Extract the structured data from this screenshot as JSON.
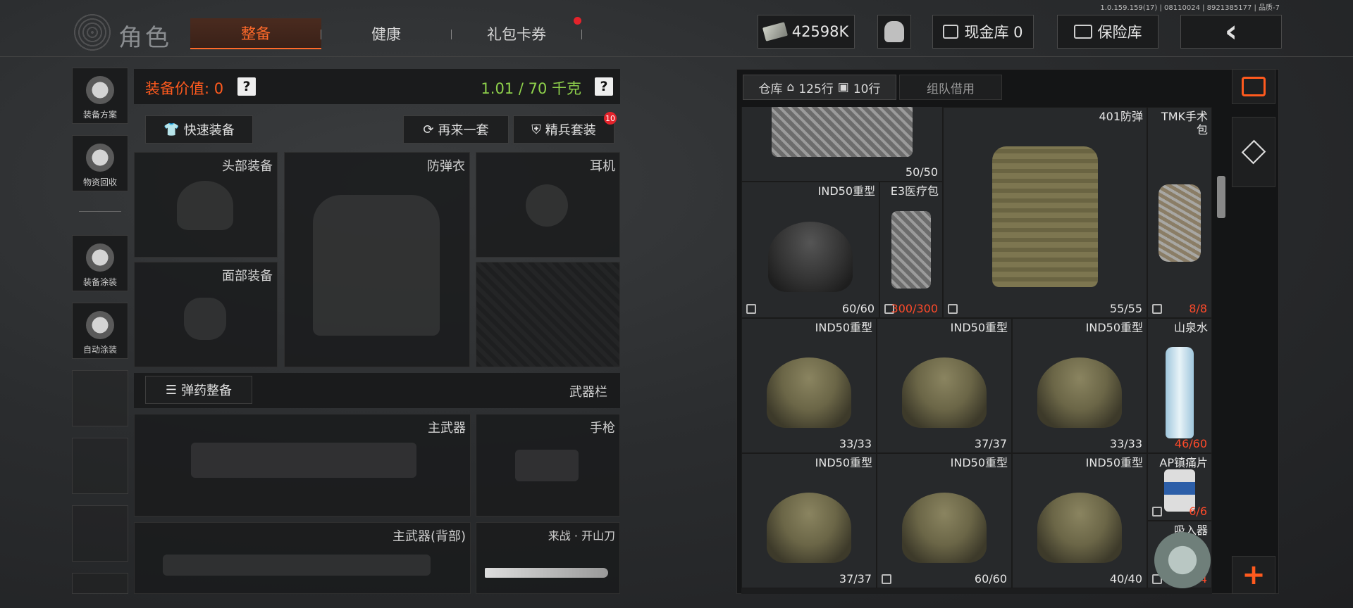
{
  "version": "1.0.159.159(17) | 08110024 | 8921385177 | 品质-7",
  "app": {
    "title": "角色"
  },
  "tabs": [
    {
      "label": "整备",
      "active": true
    },
    {
      "label": "健康",
      "active": false
    },
    {
      "label": "礼包卡券",
      "active": false,
      "has_dot": true
    }
  ],
  "topbar": {
    "currency": "42598K",
    "cash_vault": "现金库 0",
    "safe": "保险库"
  },
  "sidebar": [
    {
      "label": "装备方案",
      "icon": "helmet-grid-icon"
    },
    {
      "label": "物资回收",
      "icon": "recycle-icon"
    },
    {
      "label": "装备涂装",
      "icon": "paint-helmet-icon"
    },
    {
      "label": "自动涂装",
      "icon": "auto-paint-icon"
    }
  ],
  "equipment": {
    "value_label": "装备价值: 0",
    "weight": "1.01 / 70 千克",
    "quick_equip": "快速装备",
    "again": "再来一套",
    "elite": "精兵套装",
    "elite_badge": "10",
    "slots": {
      "head": "头部装备",
      "armor": "防弹衣",
      "headset": "耳机",
      "face": "面部装备"
    },
    "ammo_button": "弹药整备",
    "weapon_bar": "武器栏",
    "weapons": {
      "primary": "主武器",
      "pistol": "手枪",
      "primary_back": "主武器(背部)",
      "melee": "来战 · 开山刀"
    }
  },
  "warehouse": {
    "tab_label": "仓库",
    "rows_home": "125行",
    "rows_bag": "10行",
    "team_tab": "组队借用",
    "items": [
      {
        "name": "",
        "count": "50/50",
        "type": "pouch-vest"
      },
      {
        "name": "401防弹",
        "count": "55/55",
        "type": "vest"
      },
      {
        "name": "TMK手术包",
        "count": "8/8",
        "type": "bag",
        "red": true
      },
      {
        "name": "IND50重型",
        "count": "60/60",
        "type": "helmet-dark"
      },
      {
        "name": "E3医疗包",
        "count": "300/300",
        "type": "medkit",
        "red": true
      },
      {
        "name": "IND50重型",
        "count": "33/33",
        "type": "helmet"
      },
      {
        "name": "IND50重型",
        "count": "37/37",
        "type": "helmet"
      },
      {
        "name": "IND50重型",
        "count": "33/33",
        "type": "helmet"
      },
      {
        "name": "山泉水",
        "count": "46/60",
        "type": "bottle",
        "red": true
      },
      {
        "name": "IND50重型",
        "count": "37/37",
        "type": "helmet"
      },
      {
        "name": "IND50重型",
        "count": "60/60",
        "type": "helmet"
      },
      {
        "name": "IND50重型",
        "count": "40/40",
        "type": "helmet"
      },
      {
        "name": "AP镇痛片",
        "count": "6/6",
        "type": "pills",
        "red": true
      },
      {
        "name": "吸入器",
        "count": "4/4",
        "type": "inhaler",
        "red": true
      }
    ]
  },
  "colors": {
    "accent": "#ff5a1e",
    "weight_green": "#8ed04b",
    "badge_red": "#e4232b"
  }
}
